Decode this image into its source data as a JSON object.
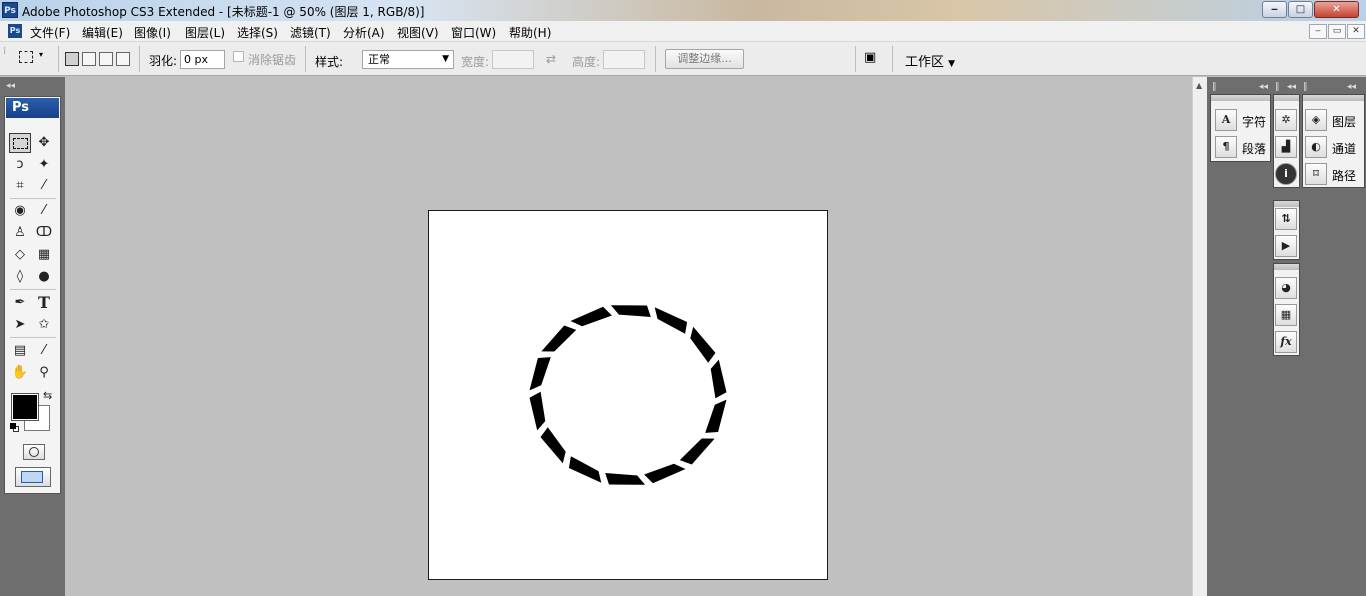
{
  "window": {
    "app_icon": "Ps",
    "title": "Adobe Photoshop CS3 Extended - [未标题-1 @ 50% (图层 1, RGB/8)]",
    "min": "‒",
    "max": "□",
    "close": "✕"
  },
  "doc_controls": {
    "min": "‒",
    "restore": "▭",
    "close": "✕"
  },
  "menu": [
    "文件(F)",
    "编辑(E)",
    "图像(I)",
    "图层(L)",
    "选择(S)",
    "滤镜(T)",
    "分析(A)",
    "视图(V)",
    "窗口(W)",
    "帮助(H)"
  ],
  "options": {
    "feather_label": "羽化:",
    "feather_value": "0 px",
    "antialias_label": "消除锯齿",
    "style_label": "样式:",
    "style_value": "正常",
    "width_label": "宽度:",
    "height_label": "高度:",
    "refine_edge_label": "调整边缘...",
    "workspace_label": "工作区"
  },
  "toolbox": {
    "badge": "Ps",
    "tools": [
      {
        "name": "marquee-tool-icon",
        "glyph": "⬚"
      },
      {
        "name": "move-tool-icon",
        "glyph": "✥"
      },
      {
        "name": "lasso-tool-icon",
        "glyph": "ↄ"
      },
      {
        "name": "magic-wand-icon",
        "glyph": "✦"
      },
      {
        "name": "crop-tool-icon",
        "glyph": "⌗"
      },
      {
        "name": "slice-tool-icon",
        "glyph": "⁄"
      },
      {
        "name": "spot-healing-icon",
        "glyph": "◉"
      },
      {
        "name": "brush-tool-icon",
        "glyph": "⁄"
      },
      {
        "name": "clone-stamp-icon",
        "glyph": "♙"
      },
      {
        "name": "history-brush-icon",
        "glyph": "ↀ"
      },
      {
        "name": "eraser-tool-icon",
        "glyph": "◇"
      },
      {
        "name": "gradient-tool-icon",
        "glyph": "▦"
      },
      {
        "name": "blur-tool-icon",
        "glyph": "◊"
      },
      {
        "name": "dodge-tool-icon",
        "glyph": "●"
      },
      {
        "name": "pen-tool-icon",
        "glyph": "✒"
      },
      {
        "name": "type-tool-icon",
        "glyph": "T"
      },
      {
        "name": "path-select-icon",
        "glyph": "➤"
      },
      {
        "name": "shape-tool-icon",
        "glyph": "✩"
      },
      {
        "name": "notes-tool-icon",
        "glyph": "▤"
      },
      {
        "name": "eyedropper-icon",
        "glyph": "⁄"
      },
      {
        "name": "hand-tool-icon",
        "glyph": "✋"
      },
      {
        "name": "zoom-tool-icon",
        "glyph": "⚲"
      }
    ],
    "swap_colors": "⇆",
    "foreground_color": "#000000",
    "background_color": "#ffffff"
  },
  "right_panels": {
    "text_group": [
      {
        "icon": "A",
        "label": "字符"
      },
      {
        "icon": "¶",
        "label": "段落"
      }
    ],
    "layers_group": [
      {
        "icon": "◈",
        "label": "图层"
      },
      {
        "icon": "◐",
        "label": "通道"
      },
      {
        "icon": "⌑",
        "label": "路径"
      }
    ],
    "icon_column_1": [
      "✲",
      "▟",
      "i"
    ],
    "icon_column_2": [
      "⇅",
      "▶"
    ],
    "icon_column_3": [
      "◕",
      "▦",
      "fx"
    ]
  },
  "canvas": {
    "ring_color": "#000000"
  }
}
